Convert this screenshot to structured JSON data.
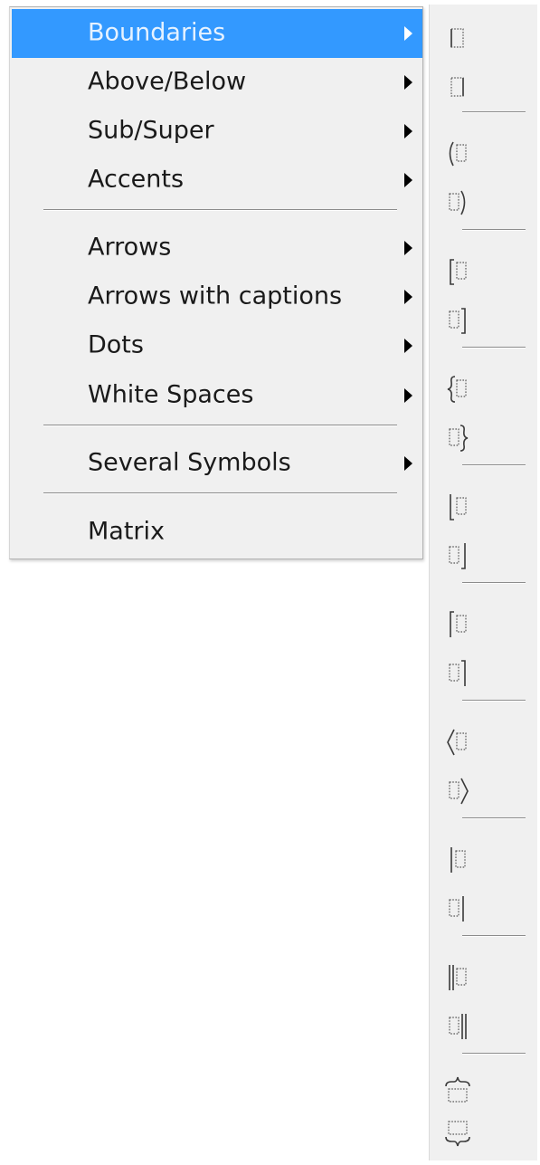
{
  "menu": {
    "items": [
      {
        "label": "Boundaries",
        "highlighted": true
      },
      {
        "label": "Above/Below"
      },
      {
        "label": "Sub/Super"
      },
      {
        "label": "Accents"
      },
      {
        "label": "Arrows"
      },
      {
        "label": "Arrows with captions"
      },
      {
        "label": "Dots"
      },
      {
        "label": "White Spaces"
      },
      {
        "label": "Several Symbols"
      },
      {
        "label": "Matrix"
      }
    ]
  },
  "submenu": {
    "items": [
      {
        "icon": "placeholder-left-align-icon"
      },
      {
        "icon": "placeholder-right-align-icon"
      },
      {
        "icon": "open-parenthesis-icon"
      },
      {
        "icon": "close-parenthesis-icon"
      },
      {
        "icon": "open-square-bracket-icon"
      },
      {
        "icon": "close-square-bracket-icon"
      },
      {
        "icon": "open-curly-brace-icon"
      },
      {
        "icon": "close-curly-brace-icon"
      },
      {
        "icon": "left-floor-icon"
      },
      {
        "icon": "right-floor-icon"
      },
      {
        "icon": "left-ceiling-icon"
      },
      {
        "icon": "right-ceiling-icon"
      },
      {
        "icon": "left-angle-bracket-icon"
      },
      {
        "icon": "right-angle-bracket-icon"
      },
      {
        "icon": "left-vertical-bar-icon"
      },
      {
        "icon": "right-vertical-bar-icon"
      },
      {
        "icon": "left-double-bar-icon"
      },
      {
        "icon": "right-double-bar-icon"
      },
      {
        "icon": "overbrace-icon"
      },
      {
        "icon": "underbrace-icon"
      }
    ]
  },
  "colors": {
    "highlight": "#3399ff",
    "highlight_text": "#e6f2ff",
    "menu_background": "#f0f0f0"
  }
}
